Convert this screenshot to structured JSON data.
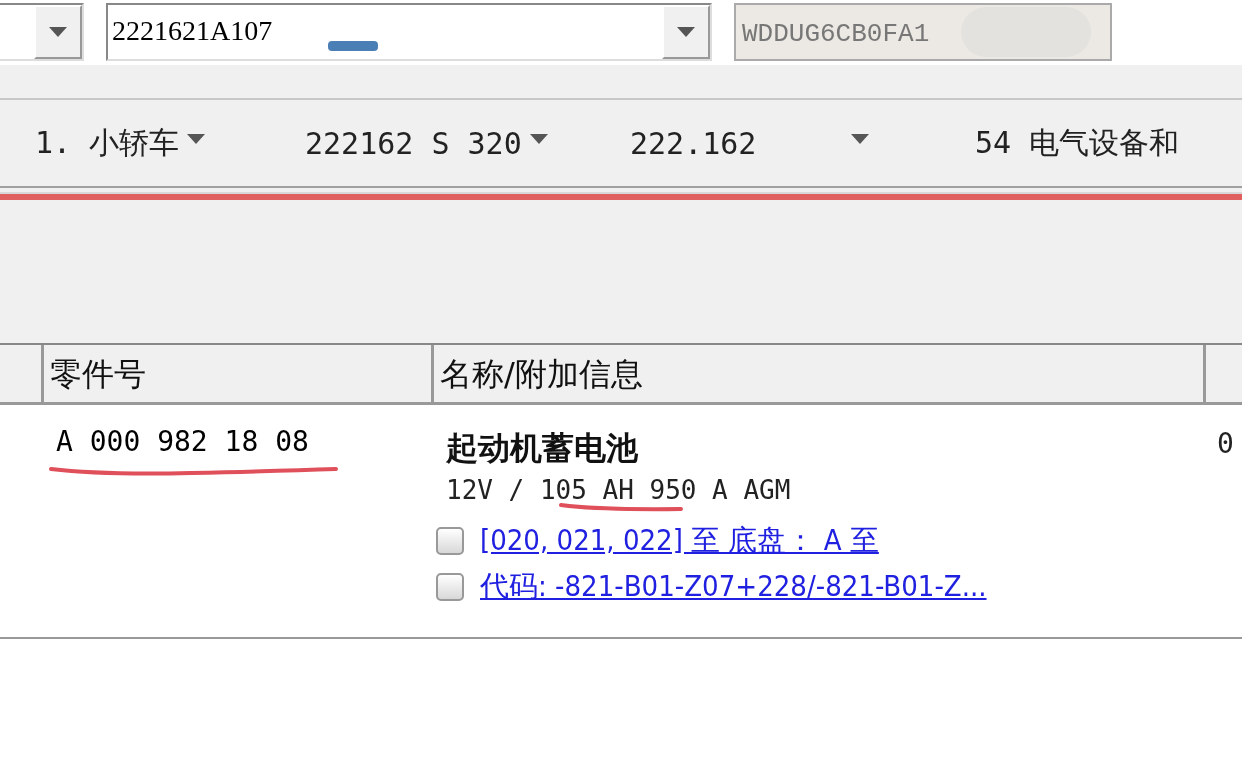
{
  "selector_bar": {
    "model_combo": {
      "value": "2221621A107"
    },
    "vin_field": {
      "value": "WDDUG6CB0FA1"
    }
  },
  "breadcrumb": [
    {
      "label": "1. 小轿车",
      "dropdown": true
    },
    {
      "label": "222162 S 320",
      "dropdown": true
    },
    {
      "label": "222.162",
      "dropdown": true
    },
    {
      "label": "54 电气设备和",
      "dropdown": false
    }
  ],
  "table": {
    "columns": [
      {
        "label": "零件号"
      },
      {
        "label": "名称/附加信息"
      }
    ],
    "rows": [
      {
        "part_number": "A 000 982 18 08",
        "name": "起动机蓄电池",
        "info_start": "12V / ",
        "info_marked": "105 AH",
        "info_end": " 950 A AGM",
        "notes": [
          "[020, 021, 022] 至 底盘： A 至",
          "代码: -821-B01-Z07+228/-821-B01-Z..."
        ],
        "quantity": "0"
      }
    ]
  }
}
